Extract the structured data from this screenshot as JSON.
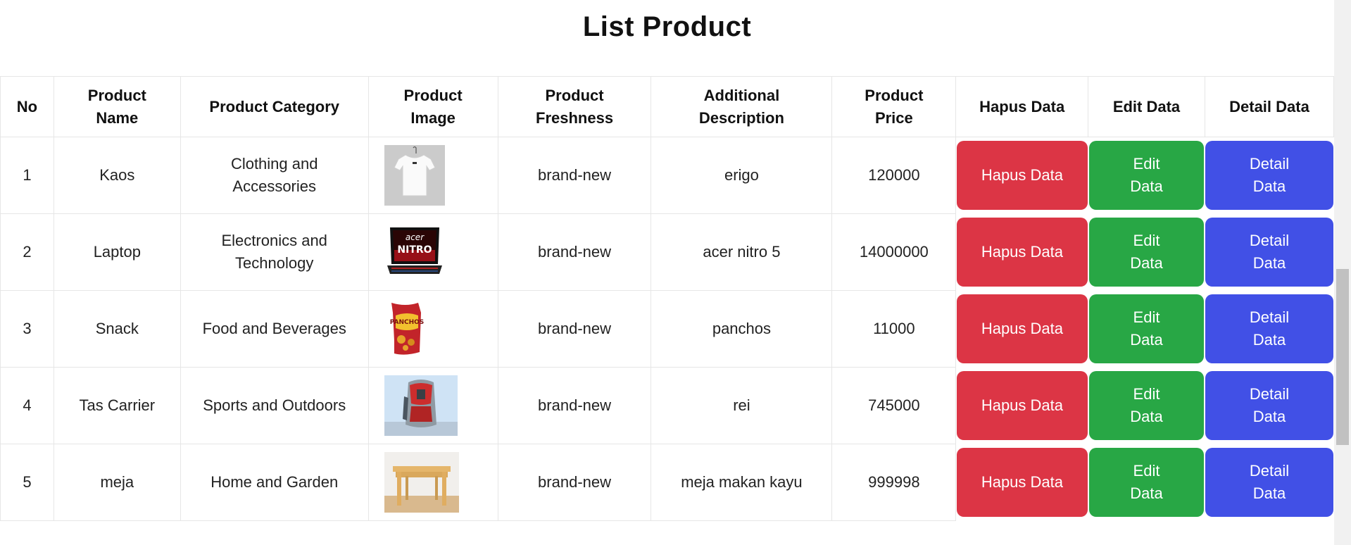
{
  "title": "List Product",
  "columns": [
    "No",
    "Product Name",
    "Product Category",
    "Product Image",
    "Product Freshness",
    "Additional Description",
    "Product Price",
    "Hapus Data",
    "Edit Data",
    "Detail Data"
  ],
  "rows": [
    {
      "no": "1",
      "name": "Kaos",
      "category": "Clothing and Accessories",
      "image": "white-tshirt-image",
      "freshness": "brand-new",
      "description": "erigo",
      "price": "120000",
      "hapus": "Hapus Data",
      "edit": "Edit Data",
      "detail": "Detail Data"
    },
    {
      "no": "2",
      "name": "Laptop",
      "category": "Electronics and Technology",
      "image": "acer-nitro-laptop-image",
      "freshness": "brand-new",
      "description": "acer nitro 5",
      "price": "14000000",
      "hapus": "Hapus Data",
      "edit": "Edit Data",
      "detail": "Detail Data"
    },
    {
      "no": "3",
      "name": "Snack",
      "category": "Food and Beverages",
      "image": "chips-bag-image",
      "freshness": "brand-new",
      "description": "panchos",
      "price": "11000",
      "hapus": "Hapus Data",
      "edit": "Edit Data",
      "detail": "Detail Data"
    },
    {
      "no": "4",
      "name": "Tas Carrier",
      "category": "Sports and Outdoors",
      "image": "backpack-image",
      "freshness": "brand-new",
      "description": "rei",
      "price": "745000",
      "hapus": "Hapus Data",
      "edit": "Edit Data",
      "detail": "Detail Data"
    },
    {
      "no": "5",
      "name": "meja",
      "category": "Home and Garden",
      "image": "wooden-table-image",
      "freshness": "brand-new",
      "description": "meja makan kayu",
      "price": "999998",
      "hapus": "Hapus Data",
      "edit": "Edit Data",
      "detail": "Detail Data"
    }
  ],
  "colors": {
    "hapus": "#dc3545",
    "edit": "#28a745",
    "detail": "#4150e6"
  }
}
